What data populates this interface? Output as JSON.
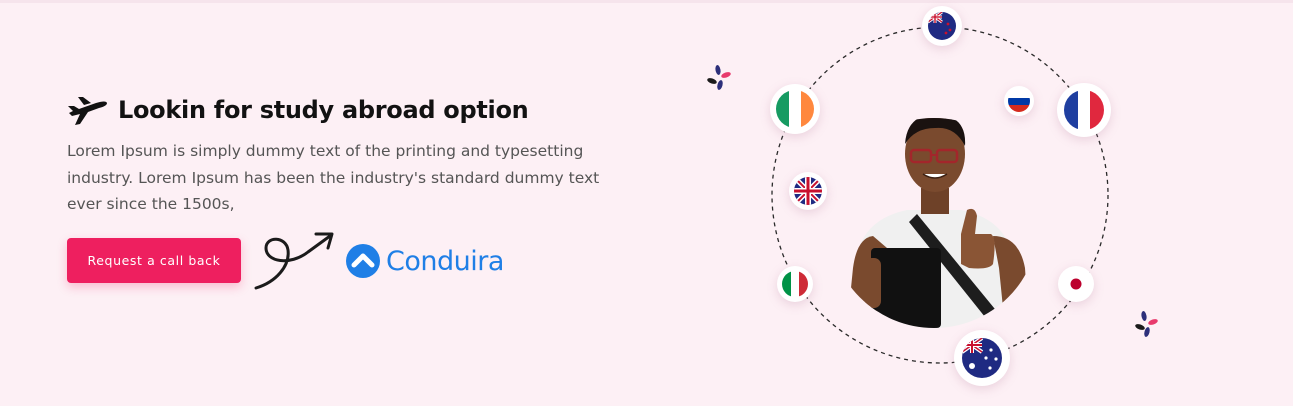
{
  "theme": {
    "background": "#fdf0f5",
    "accent": "#ee1f5f",
    "brand": "#1f7fe6"
  },
  "hero": {
    "icon": "airplane-icon",
    "title": "Lookin for study abroad option",
    "description": "Lorem Ipsum is simply dummy text of the printing and typesetting industry. Lorem Ipsum has been the industry's standard dummy text ever since the 1500s,",
    "cta_label": "Request a call back"
  },
  "partner": {
    "icon": "chevron-up-icon",
    "name": "Conduira"
  },
  "illustration": {
    "person": "student-holding-folder-thumbs-up",
    "flags": [
      "new-zealand",
      "ireland",
      "russia",
      "france",
      "united-kingdom",
      "italy",
      "japan",
      "australia"
    ]
  }
}
